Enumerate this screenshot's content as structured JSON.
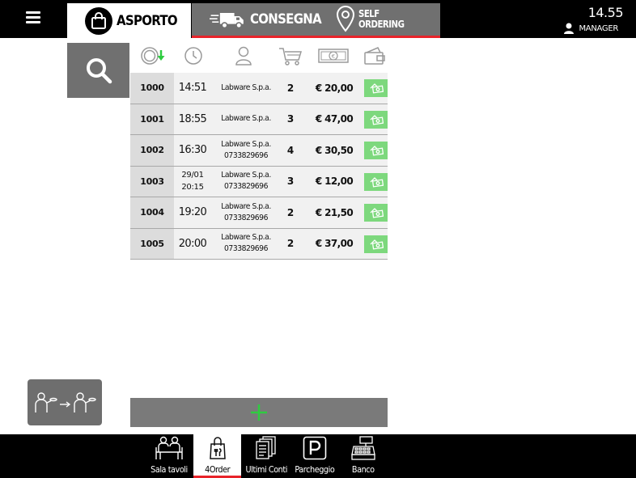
{
  "topbar": {
    "tabs": {
      "asporto": "ASPORTO",
      "consegna": "CONSEGNA",
      "self_ordering_line1": "SELF",
      "self_ordering_line2": "ORDERING"
    },
    "clock": "14.55",
    "user": "MANAGER"
  },
  "table": {
    "columns": [
      "sort-order",
      "time",
      "customer",
      "quantity",
      "amount",
      "payment"
    ],
    "rows": [
      {
        "id": "1000",
        "time": "14:51",
        "date": "",
        "customer": "Labware S.p.a.",
        "phone": "",
        "qty": "2",
        "amount": "€ 20,00"
      },
      {
        "id": "1001",
        "time": "18:55",
        "date": "",
        "customer": "Labware S.p.a.",
        "phone": "",
        "qty": "3",
        "amount": "€ 47,00"
      },
      {
        "id": "1002",
        "time": "16:30",
        "date": "",
        "customer": "Labware S.p.a.",
        "phone": "0733829696",
        "qty": "4",
        "amount": "€ 30,50"
      },
      {
        "id": "1003",
        "time": "20:15",
        "date": "29/01",
        "customer": "Labware S.p.a.",
        "phone": "0733829696",
        "qty": "3",
        "amount": "€ 12,00"
      },
      {
        "id": "1004",
        "time": "19:20",
        "date": "",
        "customer": "Labware S.p.a.",
        "phone": "0733829696",
        "qty": "2",
        "amount": "€ 21,50"
      },
      {
        "id": "1005",
        "time": "20:00",
        "date": "",
        "customer": "Labware S.p.a.",
        "phone": "0733829696",
        "qty": "2",
        "amount": "€ 37,00"
      }
    ]
  },
  "bottom_nav": [
    {
      "label": "Sala tavoli",
      "icon": "tables-icon",
      "active": false
    },
    {
      "label": "4Order",
      "icon": "shopping-bag-icon",
      "active": true
    },
    {
      "label": "Ultimi Conti",
      "icon": "receipts-icon",
      "active": false
    },
    {
      "label": "Parcheggio",
      "icon": "parking-icon",
      "active": false
    },
    {
      "label": "Banco",
      "icon": "cash-register-icon",
      "active": false
    }
  ],
  "colors": {
    "accent_red": "#e8232a",
    "pay_green": "#7dd87d",
    "add_green": "#2ecc40",
    "panel_gray": "#707070"
  }
}
